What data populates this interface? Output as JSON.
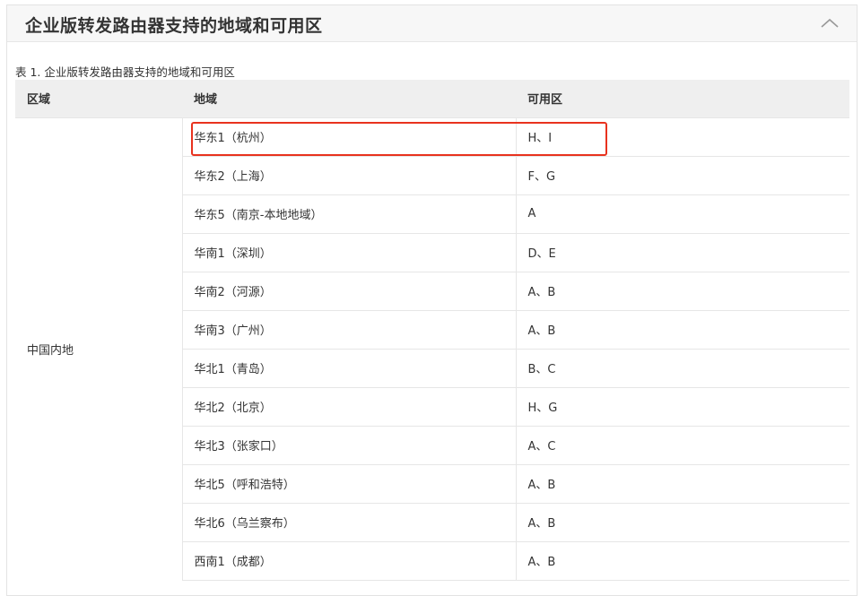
{
  "section": {
    "title": "企业版转发路由器支持的地域和可用区",
    "collapse_icon": "chevron-up-icon"
  },
  "table": {
    "caption": "表 1. 企业版转发路由器支持的地域和可用区",
    "headers": {
      "area": "区域",
      "region": "地域",
      "zones": "可用区"
    },
    "area_group": "中国内地",
    "rows": [
      {
        "region": "华东1（杭州）",
        "zones": "H、I"
      },
      {
        "region": "华东2（上海）",
        "zones": "F、G"
      },
      {
        "region": "华东5（南京-本地地域）",
        "zones": "A"
      },
      {
        "region": "华南1（深圳）",
        "zones": "D、E"
      },
      {
        "region": "华南2（河源）",
        "zones": "A、B"
      },
      {
        "region": "华南3（广州）",
        "zones": "A、B"
      },
      {
        "region": "华北1（青岛）",
        "zones": "B、C"
      },
      {
        "region": "华北2（北京）",
        "zones": "H、G"
      },
      {
        "region": "华北3（张家口）",
        "zones": "A、C"
      },
      {
        "region": "华北5（呼和浩特）",
        "zones": "A、B"
      },
      {
        "region": "华北6（乌兰察布）",
        "zones": "A、B"
      },
      {
        "region": "西南1（成都）",
        "zones": "A、B"
      }
    ]
  },
  "colors": {
    "highlight_border": "#e8321e",
    "header_bg": "#efefef",
    "panel_header_bg": "#f7f7f7"
  }
}
